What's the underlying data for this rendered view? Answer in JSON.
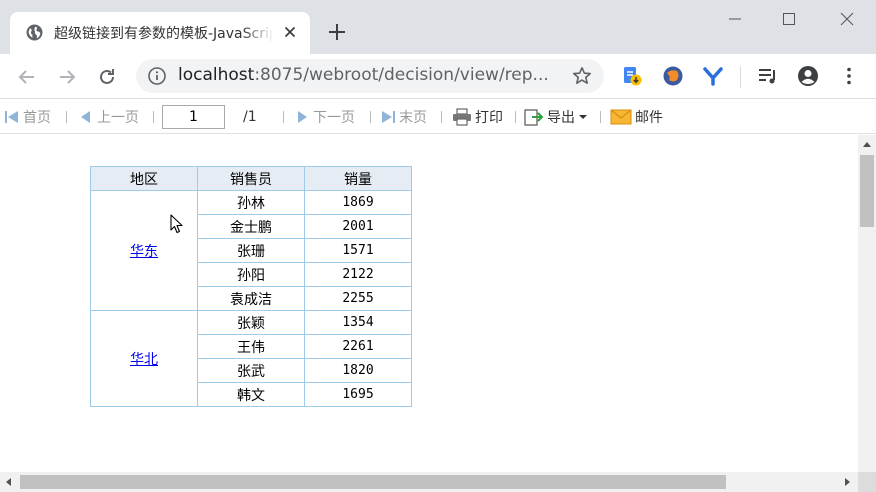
{
  "browser": {
    "tab_title": "超级链接到有参数的模板-JavaScript",
    "url_host": "localhost",
    "url_rest": ":8075/webroot/decision/view/rep..."
  },
  "toolbar": {
    "first_label": "首页",
    "prev_label": "上一页",
    "page_value": "1",
    "page_total": "/1",
    "next_label": "下一页",
    "last_label": "末页",
    "print_label": "打印",
    "export_label": "导出",
    "mail_label": "邮件"
  },
  "table": {
    "headers": [
      "地区",
      "销售员",
      "销量"
    ],
    "groups": [
      {
        "region": "华东",
        "rows": [
          {
            "name": "孙林",
            "qty": "1869"
          },
          {
            "name": "金士鹏",
            "qty": "2001"
          },
          {
            "name": "张珊",
            "qty": "1571"
          },
          {
            "name": "孙阳",
            "qty": "2122"
          },
          {
            "name": "袁成洁",
            "qty": "2255"
          }
        ]
      },
      {
        "region": "华北",
        "rows": [
          {
            "name": "张颖",
            "qty": "1354"
          },
          {
            "name": "王伟",
            "qty": "2261"
          },
          {
            "name": "张武",
            "qty": "1820"
          },
          {
            "name": "韩文",
            "qty": "1695"
          }
        ]
      }
    ]
  },
  "colors": {
    "border": "#9ecbea",
    "header_bg": "#e6ecf3",
    "link": "#0000ee",
    "chrome_frame": "#dee1e6"
  }
}
